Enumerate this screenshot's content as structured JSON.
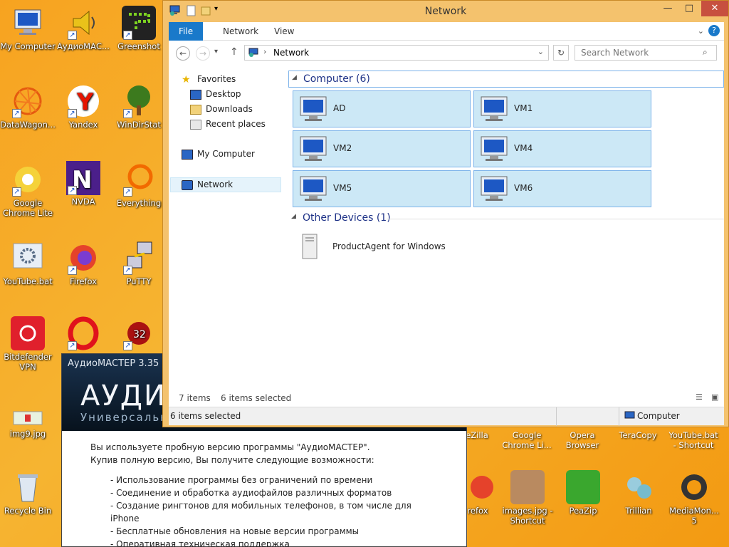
{
  "desktop": {
    "icons": [
      {
        "label": "My Computer",
        "x": "mycomp"
      },
      {
        "label": "АудиоМАС...",
        "x": "audio"
      },
      {
        "label": "Greenshot",
        "x": "gs"
      },
      {
        "label": "DataWagon...",
        "x": "dw"
      },
      {
        "label": "Yandex",
        "x": "ya"
      },
      {
        "label": "WinDirStat",
        "x": "wds"
      },
      {
        "label": "Google Chrome Lite",
        "x": "gc"
      },
      {
        "label": "NVDA",
        "x": "nvda"
      },
      {
        "label": "Everything",
        "x": "ev"
      },
      {
        "label": "YouTube.bat",
        "x": "yt"
      },
      {
        "label": "Firefox",
        "x": "ff"
      },
      {
        "label": "PuTTY",
        "x": "putty"
      },
      {
        "label": "Bitdefender VPN",
        "x": "bd"
      },
      {
        "label": "img9.jpg",
        "x": "img9"
      },
      {
        "label": "Recycle Bin",
        "x": "rb"
      }
    ],
    "bottom_row_top": [
      "eZilla",
      "Google Chrome Li...",
      "Opera Browser",
      "TeraCopy",
      "YouTube.bat - Shortcut"
    ],
    "bottom_row": [
      "refox",
      "images.jpg - Shortcut",
      "PeaZip",
      "Trillian",
      "MediaMon... 5"
    ],
    "badge_32": "32"
  },
  "audio_window": {
    "title": "АудиоМАСТЕР 3.35",
    "big": "АУДИ",
    "sub": "Универсальн",
    "line1": "Вы используете пробную версию программы \"АудиоМАСТЕР\".",
    "line2": "Купив полную версию, Вы получите следующие возможности:",
    "features": [
      "- Использование программы без ограничений по времени",
      "- Соединение и обработка аудиофайлов различных форматов",
      "- Создание рингтонов для мобильных телефонов, в том числе для iPhone",
      "- Бесплатные обновления на новые версии программы",
      "- Оперативная техническая поддержка"
    ]
  },
  "explorer": {
    "title": "Network",
    "tabs": {
      "file": "File",
      "network": "Network",
      "view": "View"
    },
    "address": "Network",
    "search_placeholder": "Search Network",
    "nav": {
      "favorites": "Favorites",
      "desktop": "Desktop",
      "downloads": "Downloads",
      "recent": "Recent places",
      "mycomputer": "My Computer",
      "network": "Network"
    },
    "groups": {
      "computer": "Computer (6)",
      "other": "Other Devices (1)"
    },
    "computers": [
      "AD",
      "VM1",
      "VM2",
      "VM4",
      "VM5",
      "VM6"
    ],
    "other_devices": [
      "ProductAgent for Windows"
    ],
    "status_items": "7 items",
    "status_selected": "6 items selected",
    "bottom_selected": "6 items selected",
    "bottom_location": "Computer"
  }
}
